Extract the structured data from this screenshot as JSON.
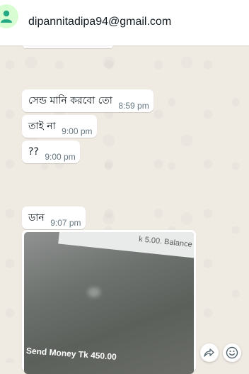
{
  "header": {
    "contact_name": "dipannitadipa94@gmail.com",
    "avatar_icon": "person-icon"
  },
  "messages": [
    {
      "text": "সেন্ড মানি করবো তো",
      "time": "8:59 pm"
    },
    {
      "text": "তাই না",
      "time": "9:00 pm"
    },
    {
      "text": "??",
      "time": "9:00 pm"
    },
    {
      "text": "ডান",
      "time": "9:07 pm"
    }
  ],
  "image_message": {
    "photo_top_text": "k 5.00. Balance",
    "photo_bottom_text": "Send Money Tk 450.00"
  },
  "actions": {
    "forward_icon": "forward-icon",
    "emoji_icon": "emoji-icon"
  },
  "colors": {
    "wallpaper": "#efeae2",
    "bubble": "#ffffff",
    "timestamp": "#667781",
    "avatar_bg": "#d9fdd3",
    "avatar_fg": "#25a884"
  }
}
